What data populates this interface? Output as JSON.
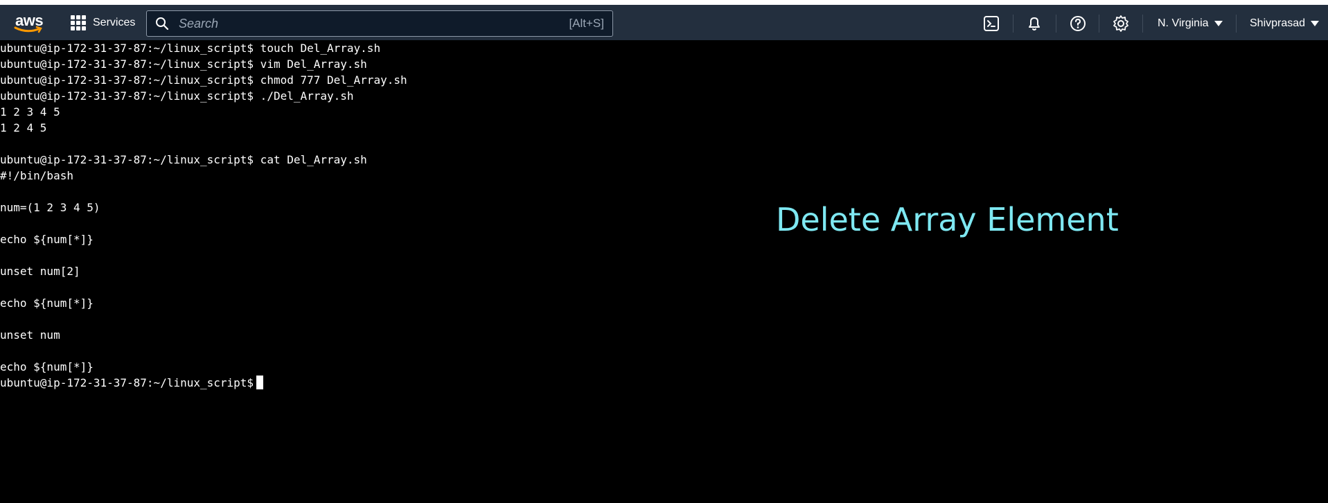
{
  "navbar": {
    "logo_text": "aws",
    "services_label": "Services",
    "search_placeholder": "Search",
    "search_shortcut": "[Alt+S]",
    "region_label": "N. Virginia",
    "user_label": "Shivprasad",
    "icons": [
      "cloudshell-icon",
      "bell-icon",
      "help-icon",
      "settings-icon"
    ]
  },
  "terminal": {
    "lines": [
      "ubuntu@ip-172-31-37-87:~/linux_script$ touch Del_Array.sh",
      "ubuntu@ip-172-31-37-87:~/linux_script$ vim Del_Array.sh",
      "ubuntu@ip-172-31-37-87:~/linux_script$ chmod 777 Del_Array.sh",
      "ubuntu@ip-172-31-37-87:~/linux_script$ ./Del_Array.sh",
      "1 2 3 4 5",
      "1 2 4 5",
      "",
      "ubuntu@ip-172-31-37-87:~/linux_script$ cat Del_Array.sh",
      "#!/bin/bash",
      "",
      "num=(1 2 3 4 5)",
      "",
      "echo ${num[*]}",
      "",
      "unset num[2]",
      "",
      "echo ${num[*]}",
      "",
      "unset num",
      "",
      "echo ${num[*]}"
    ],
    "prompt": "ubuntu@ip-172-31-37-87:~/linux_script$"
  },
  "overlay": {
    "title": "Delete Array Element",
    "color": "#7ee8f2"
  },
  "colors": {
    "navbar_bg": "#232f3e",
    "terminal_bg": "#000000",
    "terminal_fg": "#ffffff"
  }
}
